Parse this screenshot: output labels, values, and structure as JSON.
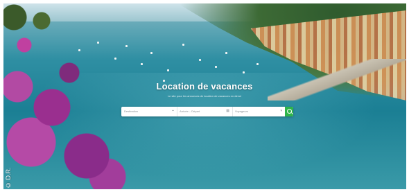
{
  "hero": {
    "title": "Location de vacances",
    "subtitle": "Le site pour les annonces de location de vacances en direct"
  },
  "search": {
    "destination_placeholder": "Destination",
    "dates_placeholder": "Arrivée – Départ",
    "guests_placeholder": "Voyageurs",
    "button_icon": "search-icon",
    "button_color": "#2eb44a"
  },
  "photo_credit": "© D.R."
}
